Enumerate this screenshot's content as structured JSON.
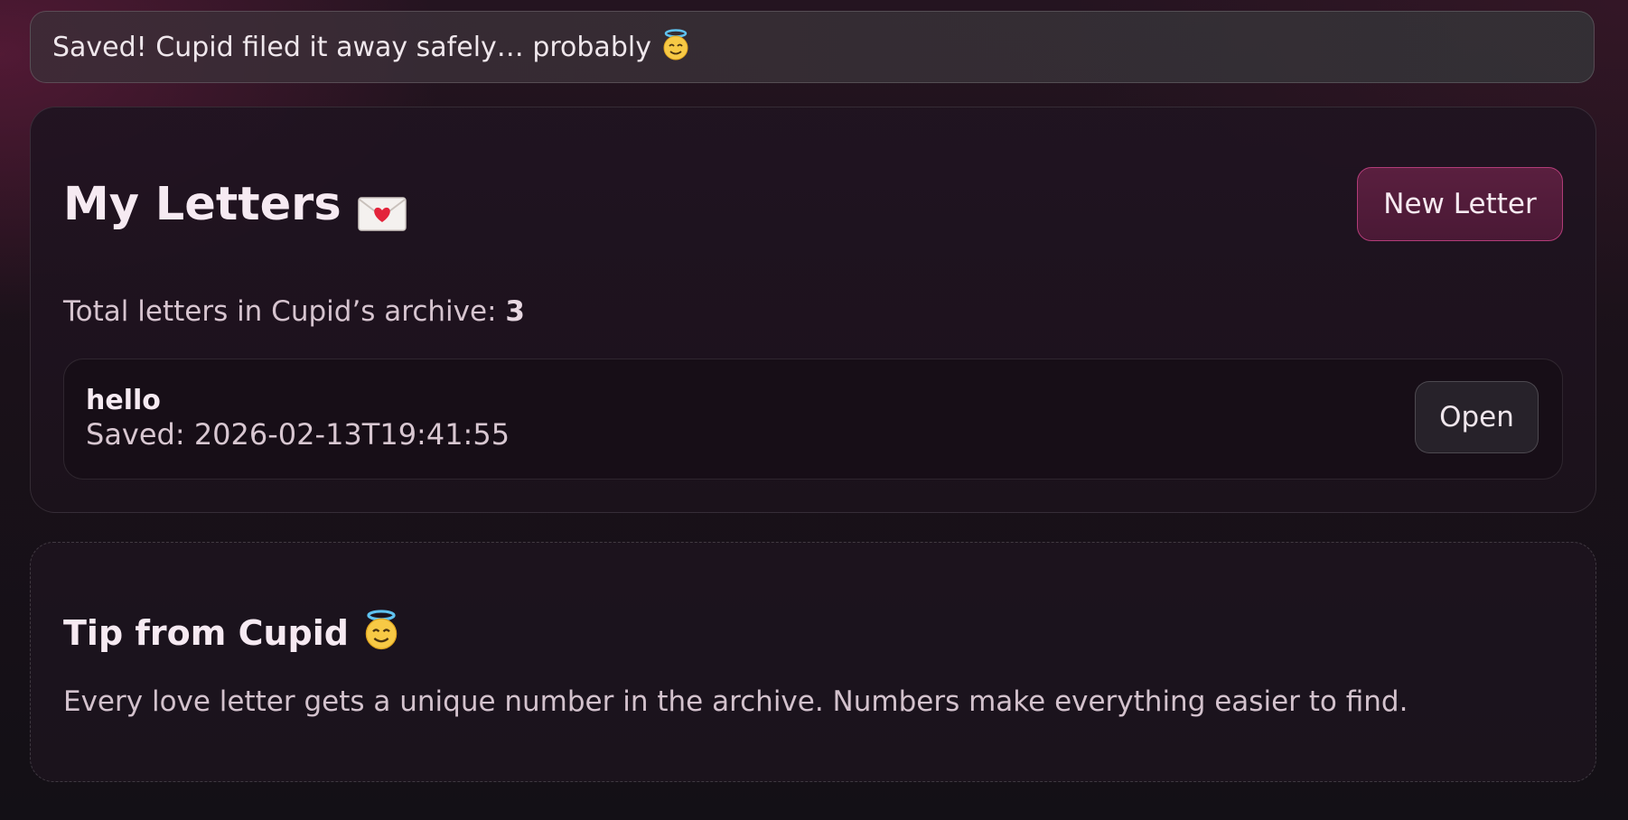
{
  "toast": {
    "message": "Saved! Cupid filed it away safely… probably",
    "icon": "smiling-face-with-halo-icon"
  },
  "letters": {
    "title": "My Letters",
    "title_icon": "love-letter-envelope-icon",
    "new_button": "New Letter",
    "total_label": "Total letters in Cupid’s archive:",
    "total_count": "3",
    "items": [
      {
        "title": "hello",
        "saved": "Saved: 2026-02-13T19:41:55",
        "open_label": "Open"
      }
    ]
  },
  "tip": {
    "title": "Tip from Cupid",
    "title_icon": "smiling-face-with-halo-icon",
    "text": "Every love letter gets a unique number in the archive. Numbers make everything easier to find."
  },
  "colors": {
    "accent_border": "#b23c78",
    "accent_fill": "#5a1f3f"
  }
}
